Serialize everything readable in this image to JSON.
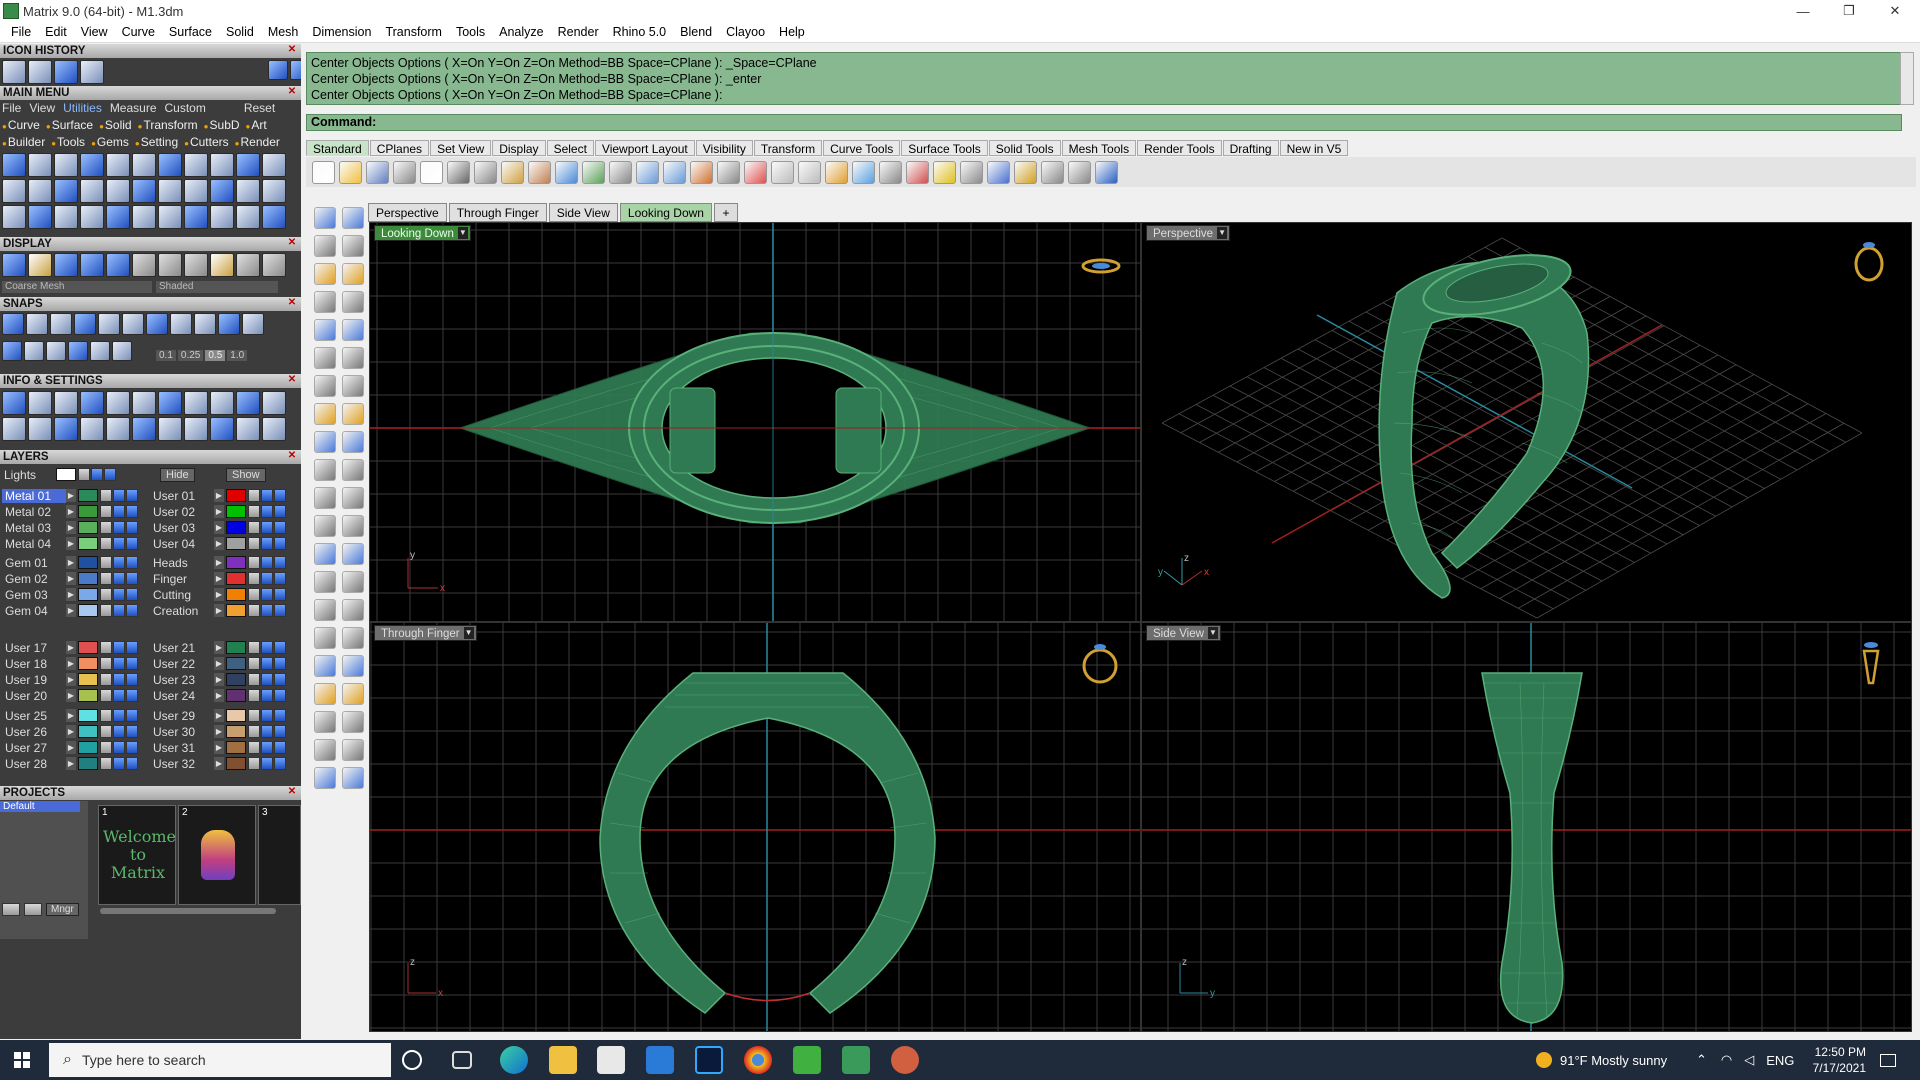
{
  "window": {
    "title": "Matrix 9.0 (64-bit) - M1.3dm",
    "min_icon": "minimize-icon",
    "max_icon": "restore-icon",
    "close_icon": "close-icon"
  },
  "menubar": [
    "File",
    "Edit",
    "View",
    "Curve",
    "Surface",
    "Solid",
    "Mesh",
    "Dimension",
    "Transform",
    "Tools",
    "Analyze",
    "Render",
    "Rhino 5.0",
    "Blend",
    "Clayoo",
    "Help"
  ],
  "left_panel": {
    "icon_history": "ICON HISTORY",
    "main_menu": "MAIN MENU",
    "main_menu_items": [
      "File",
      "View",
      "Utilities",
      "Measure",
      "Custom",
      "Reset"
    ],
    "categories_row1": [
      "Curve",
      "Surface",
      "Solid",
      "Transform",
      "SubD",
      "Art"
    ],
    "categories_row2": [
      "Builder",
      "Tools",
      "Gems",
      "Setting",
      "Cutters",
      "Render"
    ],
    "display": "DISPLAY",
    "display_mesh": "Coarse Mesh",
    "display_mode": "Shaded",
    "snaps": "SNAPS",
    "snap_values": [
      "0.1",
      "0.25",
      "0.5",
      "1.0"
    ],
    "info_settings": "INFO & SETTINGS",
    "layers": "LAYERS",
    "lights_label": "Lights",
    "hide_label": "Hide",
    "show_label": "Show",
    "layers_left": [
      {
        "name": "Metal 01",
        "color": "#2a8a5a"
      },
      {
        "name": "Metal 02",
        "color": "#3a9a3a"
      },
      {
        "name": "Metal 03",
        "color": "#5ab05a"
      },
      {
        "name": "Metal 04",
        "color": "#7ad07a"
      },
      {
        "name": "Gem 01",
        "color": "#2050a0"
      },
      {
        "name": "Gem 02",
        "color": "#4a7ac8"
      },
      {
        "name": "Gem 03",
        "color": "#7aa8e8"
      },
      {
        "name": "Gem 04",
        "color": "#a8c8f0"
      },
      {
        "name": "User 17",
        "color": "#e05050"
      },
      {
        "name": "User 18",
        "color": "#f09060"
      },
      {
        "name": "User 19",
        "color": "#e8c050"
      },
      {
        "name": "User 20",
        "color": "#a8c050"
      },
      {
        "name": "User 25",
        "color": "#60e0e0"
      },
      {
        "name": "User 26",
        "color": "#40c0c0"
      },
      {
        "name": "User 27",
        "color": "#20a0a0"
      },
      {
        "name": "User 28",
        "color": "#208080"
      }
    ],
    "layers_right": [
      {
        "name": "User 01",
        "color": "#e00000"
      },
      {
        "name": "User 02",
        "color": "#00c000"
      },
      {
        "name": "User 03",
        "color": "#0000e0"
      },
      {
        "name": "User 04",
        "color": "#a0a0a0"
      },
      {
        "name": "Heads",
        "color": "#8030c0"
      },
      {
        "name": "Finger",
        "color": "#e03030"
      },
      {
        "name": "Cutting",
        "color": "#f08000"
      },
      {
        "name": "Creation",
        "color": "#f0a030"
      },
      {
        "name": "User 21",
        "color": "#208050"
      },
      {
        "name": "User 22",
        "color": "#406080"
      },
      {
        "name": "User 23",
        "color": "#304060"
      },
      {
        "name": "User 24",
        "color": "#603070"
      },
      {
        "name": "User 29",
        "color": "#e8c8a8"
      },
      {
        "name": "User 30",
        "color": "#c8a070"
      },
      {
        "name": "User 31",
        "color": "#a07040"
      },
      {
        "name": "User 32",
        "color": "#805030"
      }
    ],
    "projects": "PROJECTS",
    "project_default": "Default",
    "thumbnails": [
      "1",
      "2",
      "3"
    ],
    "welcome_text": "Welcome to Matrix",
    "mngr": "Mngr"
  },
  "command": {
    "history": [
      "Center Objects Options ( X=On  Y=On  Z=On  Method=BB  Space=CPlane ): _Space=CPlane",
      "Center Objects Options ( X=On  Y=On  Z=On  Method=BB  Space=CPlane ): _enter",
      "Center Objects Options ( X=On  Y=On  Z=On  Method=BB  Space=CPlane ):"
    ],
    "prompt": "Command:"
  },
  "toolbar_tabs": [
    "Standard",
    "CPlanes",
    "Set View",
    "Display",
    "Select",
    "Viewport Layout",
    "Visibility",
    "Transform",
    "Curve Tools",
    "Surface Tools",
    "Solid Tools",
    "Mesh Tools",
    "Render Tools",
    "Drafting",
    "New in V5"
  ],
  "viewport_tabs": [
    "Perspective",
    "Through Finger",
    "Side View",
    "Looking Down"
  ],
  "viewports": {
    "top_left": "Looking Down",
    "top_right": "Perspective",
    "bottom_left": "Through Finger",
    "bottom_right": "Side View"
  },
  "axes": {
    "x": "x",
    "y": "y",
    "z": "z"
  },
  "taskbar": {
    "search_placeholder": "Type here to search",
    "weather": "91°F  Mostly sunny",
    "lang": "ENG",
    "time": "12:50 PM",
    "date": "7/17/2021"
  },
  "colors": {
    "ring_green": "#2f7a52",
    "grid": "#3a3a3a",
    "accent": "#88b890"
  }
}
